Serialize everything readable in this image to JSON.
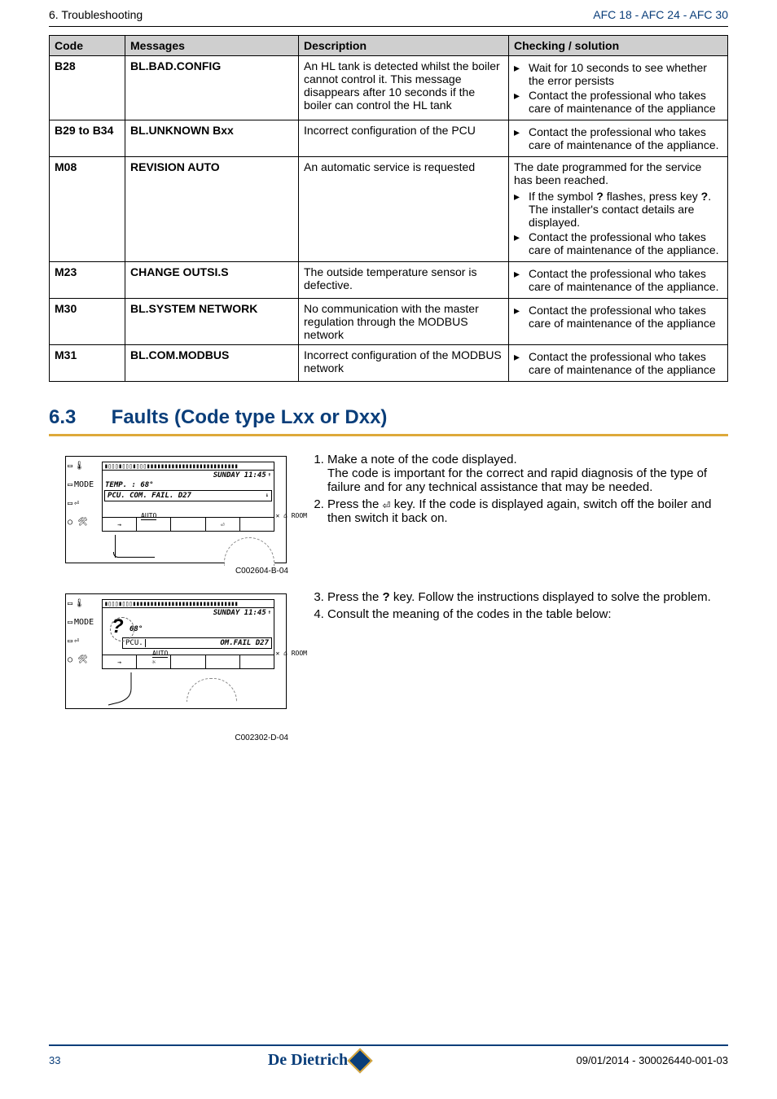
{
  "header": {
    "left": "6.  Troubleshooting",
    "right": "AFC 18 - AFC 24 - AFC 30"
  },
  "table": {
    "headers": {
      "code": "Code",
      "messages": "Messages",
      "description": "Description",
      "checking": "Checking / solution"
    },
    "rows": [
      {
        "code": "B28",
        "msg": "BL.BAD.CONFIG",
        "desc": "An HL tank is detected whilst the boiler cannot control it.\nThis message disappears after 10 seconds if the boiler can control the HL tank",
        "check_pre": "",
        "bullets": [
          "Wait for 10 seconds to see whether the error persists",
          "Contact the professional who takes care of maintenance of the appliance"
        ]
      },
      {
        "code": "B29 to B34",
        "msg": "BL.UNKNOWN Bxx",
        "desc": "Incorrect configuration of the PCU",
        "check_pre": "",
        "bullets": [
          "Contact the professional who takes care of maintenance of the appliance."
        ]
      },
      {
        "code": "M08",
        "msg": "REVISION AUTO",
        "desc": "An automatic service is requested",
        "check_pre": "The date programmed for the service has been reached.",
        "bullets": [
          "If the symbol ? flashes, press key ?. The installer's contact details are displayed.",
          "Contact the professional who takes care of maintenance of the appliance."
        ]
      },
      {
        "code": "M23",
        "msg": "CHANGE OUTSI.S",
        "desc": "The outside temperature sensor is defective.",
        "check_pre": "",
        "bullets": [
          "Contact the professional who takes care of maintenance of the appliance."
        ]
      },
      {
        "code": "M30",
        "msg": "BL.SYSTEM NETWORK",
        "desc": "No communication with the master regulation through the MODBUS network",
        "check_pre": "",
        "bullets": [
          "Contact the professional who takes care of maintenance of the appliance"
        ]
      },
      {
        "code": "M31",
        "msg": "BL.COM.MODBUS",
        "desc": "Incorrect configuration of the MODBUS network",
        "check_pre": "",
        "bullets": [
          "Contact the professional who takes care of maintenance of the appliance"
        ]
      }
    ]
  },
  "section": {
    "num": "6.3",
    "title": "Faults (Code type Lxx or Dxx)"
  },
  "lcd1": {
    "sunday": "SUNDAY 11:45",
    "temp": "TEMP. :  68°",
    "pcu": "PCU. COM. FAIL.  D27",
    "auto": "AUTO",
    "room": "⌂ ROOM",
    "mode": "MODE",
    "caption": "C002604-B-04"
  },
  "lcd2": {
    "sunday": "SUNDAY 11:45",
    "deg": "68°",
    "pcu": "OM.FAIL D27",
    "pcu_pre": "PCU.",
    "auto": "AUTO",
    "room": "⌂ ROOM",
    "mode": "MODE",
    "caption": "C002302-D-04"
  },
  "steps1": {
    "1": "Make a note of the code displayed.",
    "1sub": "The code is important for the correct and rapid diagnosis of the type of failure and for any technical assistance that may be needed.",
    "2a": "Press the ",
    "2key": "⏎",
    "2b": " key. If the code is displayed again, switch off the boiler and then switch it back on."
  },
  "steps2": {
    "3a": "Press the ",
    "3key": "?",
    "3b": " key. Follow the instructions displayed to solve the problem.",
    "4": "Consult the meaning of the codes in the table below:"
  },
  "footer": {
    "page": "33",
    "logo": "De Dietrich",
    "ref": "09/01/2014 - 300026440-001-03"
  }
}
